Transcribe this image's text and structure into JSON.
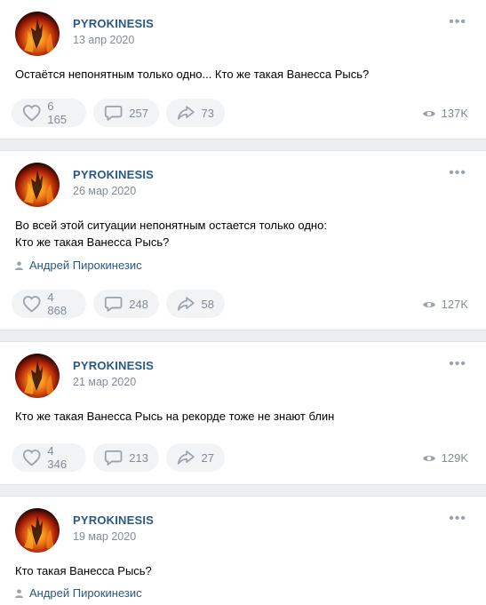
{
  "posts": [
    {
      "author": "PYROKINESIS",
      "date": "13 апр 2020",
      "text_lines": [
        "Остаётся непонятным только одно... Кто же такая Ванесса Рысь?"
      ],
      "signer": "",
      "likes": "6 165",
      "comments": "257",
      "shares": "73",
      "views": "137K"
    },
    {
      "author": "PYROKINESIS",
      "date": "26 мар 2020",
      "text_lines": [
        "Во всей этой ситуации непонятным остается только одно:",
        "Кто же такая Ванесса Рысь?"
      ],
      "signer": "Андрей Пирокинезис",
      "likes": "4 868",
      "comments": "248",
      "shares": "58",
      "views": "127K"
    },
    {
      "author": "PYROKINESIS",
      "date": "21 мар 2020",
      "text_lines": [
        "Кто же такая Ванесса Рысь на рекорде тоже не знают блин"
      ],
      "signer": "",
      "likes": "4 346",
      "comments": "213",
      "shares": "27",
      "views": "129K"
    },
    {
      "author": "PYROKINESIS",
      "date": "19 мар 2020",
      "text_lines": [
        "Кто такая Ванесса Рысь?"
      ],
      "signer": "Андрей Пирокинезис",
      "likes": "",
      "comments": "",
      "shares": "",
      "views": ""
    }
  ],
  "icons": {
    "more": "more-horizontal-icon",
    "like": "heart-icon",
    "comment": "comment-bubble-icon",
    "share": "share-arrow-icon",
    "views": "eye-icon",
    "signer": "user-icon"
  },
  "colors": {
    "link": "#2a5885",
    "secondary": "#818c99",
    "pill_bg": "#f2f3f5",
    "separator": "#edeef0"
  }
}
